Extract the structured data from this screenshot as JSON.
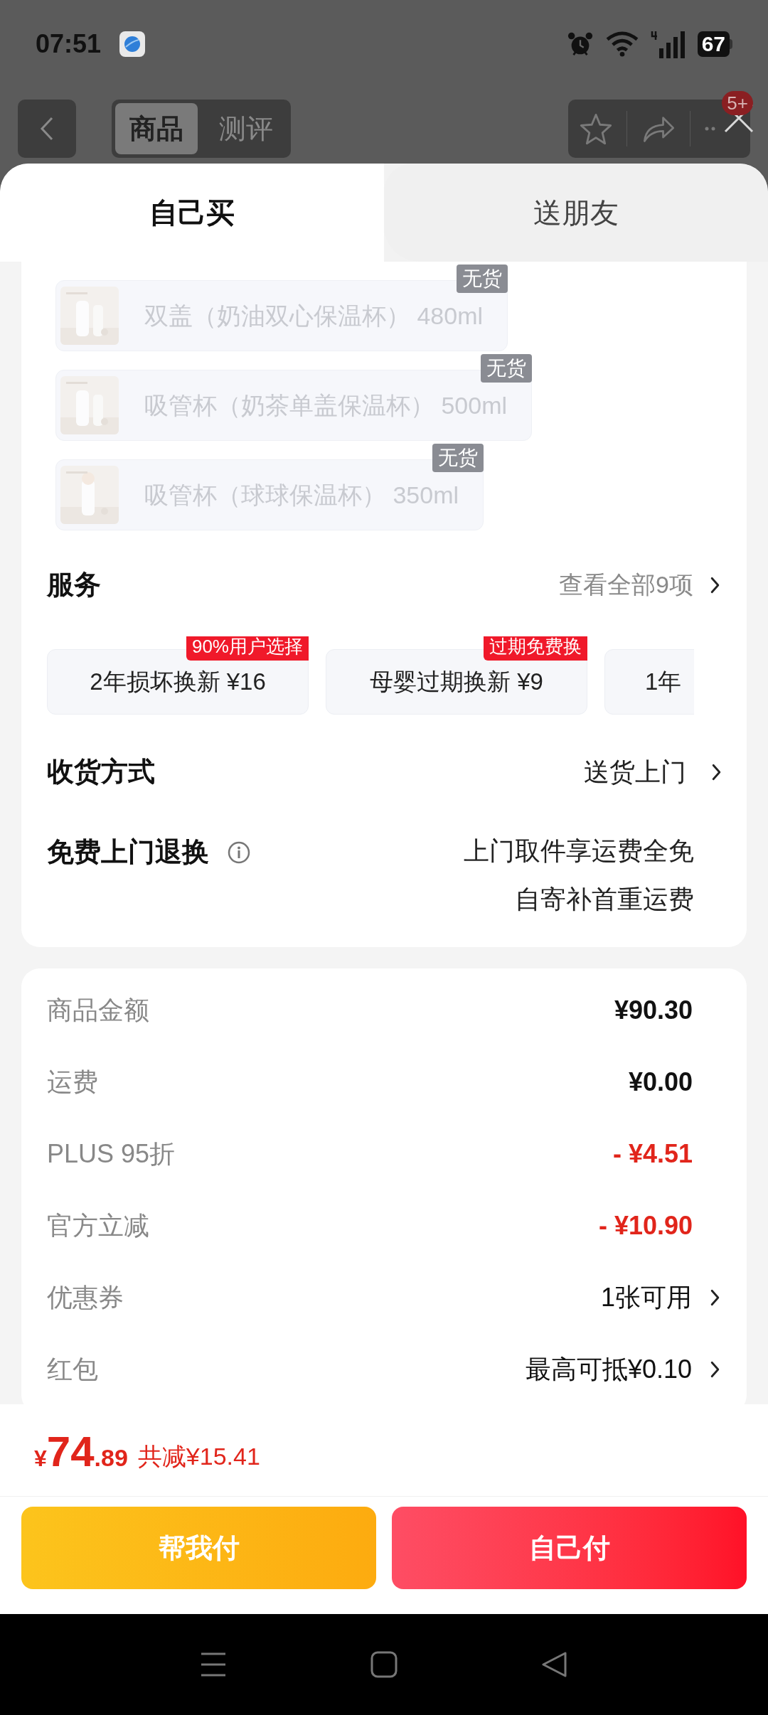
{
  "status_bar": {
    "time": "07:51",
    "battery": "67"
  },
  "nav": {
    "tabs": [
      {
        "label": "商品",
        "selected": true
      },
      {
        "label": "测评",
        "selected": false
      }
    ],
    "badge": "5+"
  },
  "sheet_tabs": [
    {
      "label": "自己买",
      "selected": true
    },
    {
      "label": "送朋友",
      "selected": false
    }
  ],
  "variants": [
    {
      "name": "双盖（奶油双心保温杯）",
      "size": "480ml",
      "badge": "无货",
      "disabled": true
    },
    {
      "name": "吸管杯（奶茶单盖保温杯）",
      "size": "500ml",
      "badge": "无货",
      "disabled": true
    },
    {
      "name": "吸管杯（球球保温杯）",
      "size": "350ml",
      "badge": "无货",
      "disabled": true
    }
  ],
  "services": {
    "title": "服务",
    "link": "查看全部9项",
    "items": [
      {
        "name": "2年损坏换新",
        "price": "¥16",
        "tag": "90%用户选择"
      },
      {
        "name": "母婴过期换新",
        "price": "¥9",
        "tag": "过期免费换"
      },
      {
        "name": "1年"
      }
    ]
  },
  "delivery": {
    "label": "收货方式",
    "value": "送货上门"
  },
  "returns": {
    "label": "免费上门退换",
    "lines": [
      "上门取件享运费全免",
      "自寄补首重运费"
    ]
  },
  "summary": [
    {
      "label": "商品金额",
      "value": "¥90.30",
      "kind": "amount",
      "chevron": false
    },
    {
      "label": "运费",
      "value": "¥0.00",
      "kind": "amount",
      "chevron": false
    },
    {
      "label": "PLUS 95折",
      "value": "- ¥4.51",
      "kind": "discount",
      "chevron": false
    },
    {
      "label": "官方立减",
      "value": "- ¥10.90",
      "kind": "discount",
      "chevron": false
    },
    {
      "label": "优惠券",
      "value": "1张可用",
      "kind": "option",
      "chevron": true
    },
    {
      "label": "红包",
      "value": "最高可抵¥0.10",
      "kind": "option",
      "chevron": true
    }
  ],
  "footer": {
    "currency": "¥",
    "integer": "74",
    "decimal": ".89",
    "saving": "共减¥15.41",
    "buttons": [
      {
        "label": "帮我付",
        "kind": "friend"
      },
      {
        "label": "自己付",
        "kind": "self"
      }
    ]
  }
}
